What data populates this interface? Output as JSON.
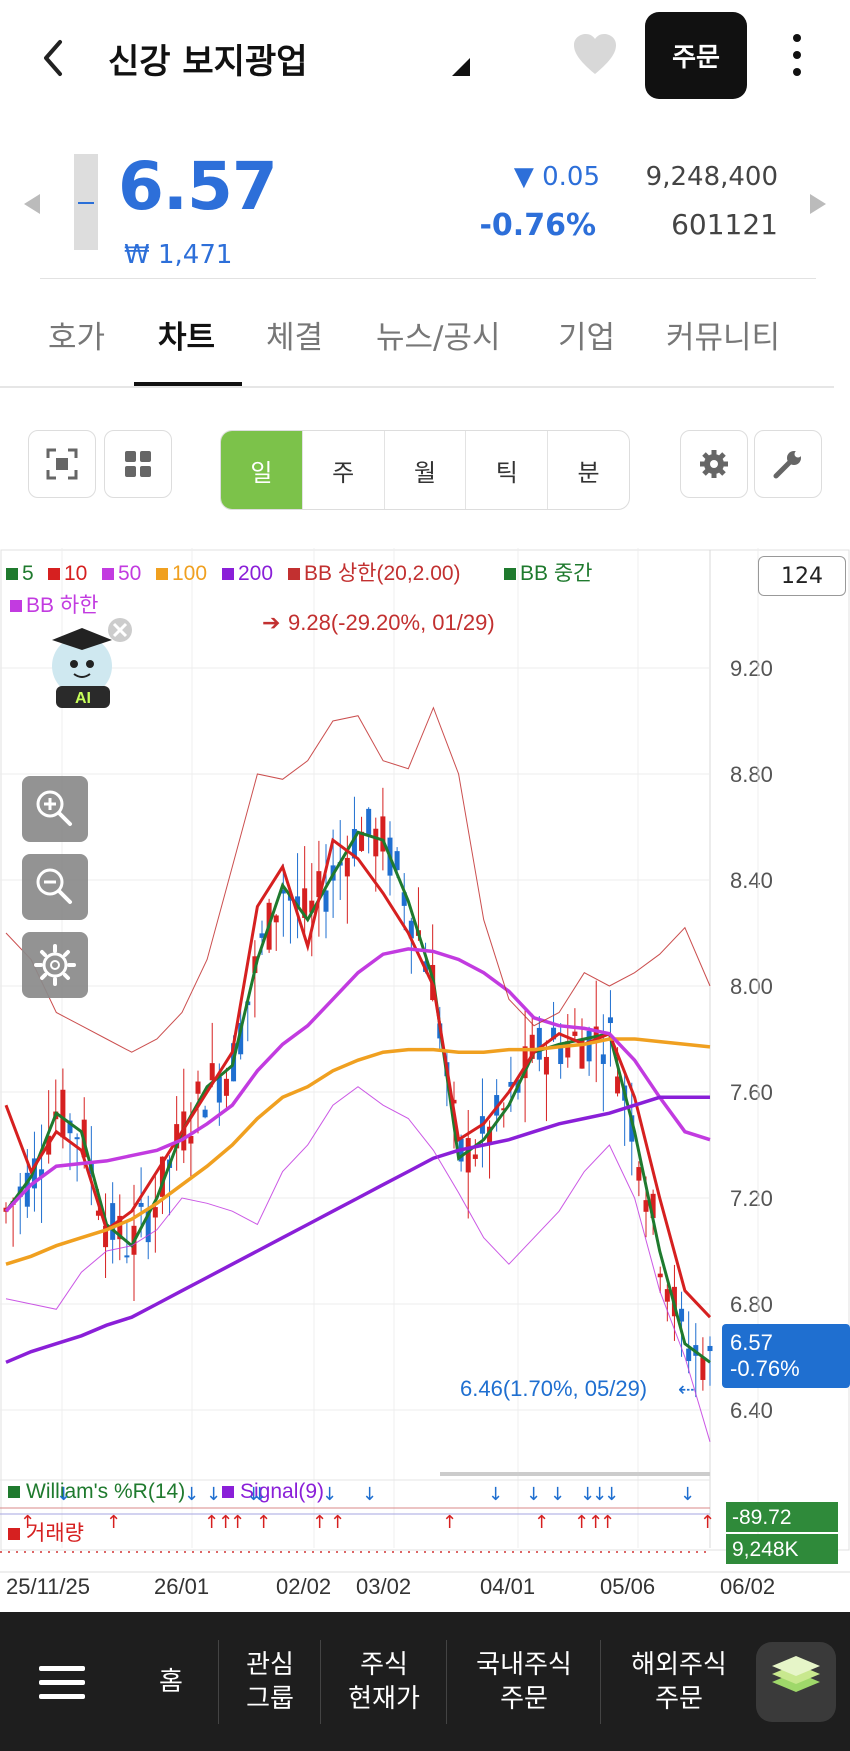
{
  "header": {
    "stock_name": "신강 보지광업",
    "order_label": "주문"
  },
  "quote": {
    "price": "6.57",
    "krw_price": "₩ 1,471",
    "change": "▼ 0.05",
    "change_pct": "-0.76%",
    "volume": "9,248,400",
    "code": "601121"
  },
  "tabs": [
    "호가",
    "차트",
    "체결",
    "뉴스/공시",
    "기업",
    "커뮤니티"
  ],
  "active_tab": "차트",
  "periods": [
    "일",
    "주",
    "월",
    "틱",
    "분"
  ],
  "active_period": "일",
  "chart": {
    "legend_line1": [
      {
        "label": "5",
        "color": "#1f7a2e"
      },
      {
        "label": "10",
        "color": "#d62020"
      },
      {
        "label": "50",
        "color": "#c23be0"
      },
      {
        "label": "100",
        "color": "#f0a020"
      },
      {
        "label": "200",
        "color": "#8a1fd8"
      },
      {
        "label": "BB 상한(20,2.00)",
        "color": "#c23030"
      },
      {
        "label": "BB 중간",
        "color": "#1f7a2e"
      }
    ],
    "legend_line2": [
      {
        "label": "BB 하한",
        "color": "#c23be0"
      }
    ],
    "count": "124",
    "high_note": "9.28(-29.20%, 01/29)",
    "low_note": "6.46(1.70%, 05/29)",
    "price_tag_value": "6.57",
    "price_tag_pct": "-0.76%",
    "ai_label": "AI",
    "indicator_legend_1": "William's %R(14)",
    "indicator_legend_2": "Signal(9)",
    "indicator_legend_3": "거래량",
    "indicator_value": "-89.72",
    "volume_value": "9,248K"
  },
  "chart_data": {
    "type": "line",
    "ylim": [
      6.2,
      9.4
    ],
    "y_ticks": [
      "9.20",
      "8.80",
      "8.40",
      "8.00",
      "7.60",
      "7.20",
      "6.80",
      "6.40"
    ],
    "x_ticks": [
      "25/11/25",
      "26/01",
      "02/02",
      "03/02",
      "04/01",
      "05/06",
      "06/02"
    ],
    "series": [
      {
        "name": "5",
        "color": "#1f7a2e",
        "values": [
          7.15,
          7.28,
          7.52,
          7.45,
          7.1,
          7.02,
          7.2,
          7.45,
          7.62,
          7.7,
          8.1,
          8.38,
          8.25,
          8.42,
          8.58,
          8.55,
          8.32,
          8.02,
          7.35,
          7.42,
          7.55,
          7.75,
          7.78,
          7.8,
          7.82,
          7.45,
          7.0,
          6.65,
          6.58
        ]
      },
      {
        "name": "10",
        "color": "#d62020",
        "values": [
          7.55,
          7.3,
          7.45,
          7.38,
          7.08,
          7.15,
          7.3,
          7.45,
          7.6,
          7.75,
          8.3,
          8.45,
          8.15,
          8.55,
          8.48,
          8.35,
          8.2,
          8.0,
          7.42,
          7.48,
          7.6,
          7.75,
          7.82,
          7.78,
          7.82,
          7.58,
          7.2,
          6.85,
          6.75
        ]
      },
      {
        "name": "100",
        "color": "#f0a020",
        "values": [
          6.95,
          6.98,
          7.02,
          7.05,
          7.08,
          7.12,
          7.18,
          7.25,
          7.32,
          7.4,
          7.5,
          7.58,
          7.62,
          7.68,
          7.72,
          7.75,
          7.76,
          7.76,
          7.75,
          7.75,
          7.76,
          7.76,
          7.77,
          7.78,
          7.8,
          7.8,
          7.79,
          7.78,
          7.77
        ]
      },
      {
        "name": "50",
        "color": "#c23be0",
        "values": [
          7.15,
          7.25,
          7.32,
          7.33,
          7.34,
          7.36,
          7.38,
          7.42,
          7.48,
          7.55,
          7.68,
          7.78,
          7.85,
          7.95,
          8.05,
          8.12,
          8.14,
          8.13,
          8.1,
          8.05,
          7.98,
          7.88,
          7.85,
          7.84,
          7.82,
          7.72,
          7.58,
          7.45,
          7.42
        ]
      },
      {
        "name": "200",
        "color": "#8a1fd8",
        "values": [
          6.58,
          6.62,
          6.65,
          6.68,
          6.72,
          6.75,
          6.8,
          6.85,
          6.9,
          6.95,
          7.0,
          7.05,
          7.1,
          7.15,
          7.2,
          7.25,
          7.3,
          7.35,
          7.38,
          7.4,
          7.42,
          7.45,
          7.48,
          7.5,
          7.52,
          7.55,
          7.58,
          7.58,
          7.58
        ]
      },
      {
        "name": "BB 상한(20,2.00)",
        "color": "#c23030",
        "values": [
          8.2,
          8.1,
          7.9,
          7.85,
          7.8,
          7.75,
          7.8,
          7.9,
          8.1,
          8.45,
          8.8,
          8.78,
          8.85,
          9.0,
          9.02,
          8.85,
          8.82,
          9.05,
          8.8,
          8.25,
          7.95,
          7.85,
          7.9,
          8.05,
          8.0,
          8.05,
          8.12,
          8.22,
          8.0
        ]
      },
      {
        "name": "BB 하한",
        "color": "#c23be0",
        "values": [
          6.82,
          6.8,
          6.78,
          6.92,
          7.0,
          7.02,
          7.08,
          7.2,
          7.18,
          7.15,
          7.1,
          7.3,
          7.4,
          7.55,
          7.62,
          7.55,
          7.5,
          7.38,
          7.22,
          7.05,
          6.95,
          7.05,
          7.15,
          7.3,
          7.4,
          7.2,
          6.85,
          6.6,
          6.28
        ]
      }
    ]
  },
  "bottom_nav": [
    {
      "label": "홈"
    },
    {
      "label": "관심\n그룹"
    },
    {
      "label": "주식\n현재가"
    },
    {
      "label": "국내주식\n주문"
    },
    {
      "label": "해외주식\n주문"
    }
  ],
  "colors": {
    "accent_blue": "#2d6fd9",
    "accent_green": "#7cc24a",
    "down_blue": "#1f6fd0",
    "up_red": "#d62020"
  }
}
